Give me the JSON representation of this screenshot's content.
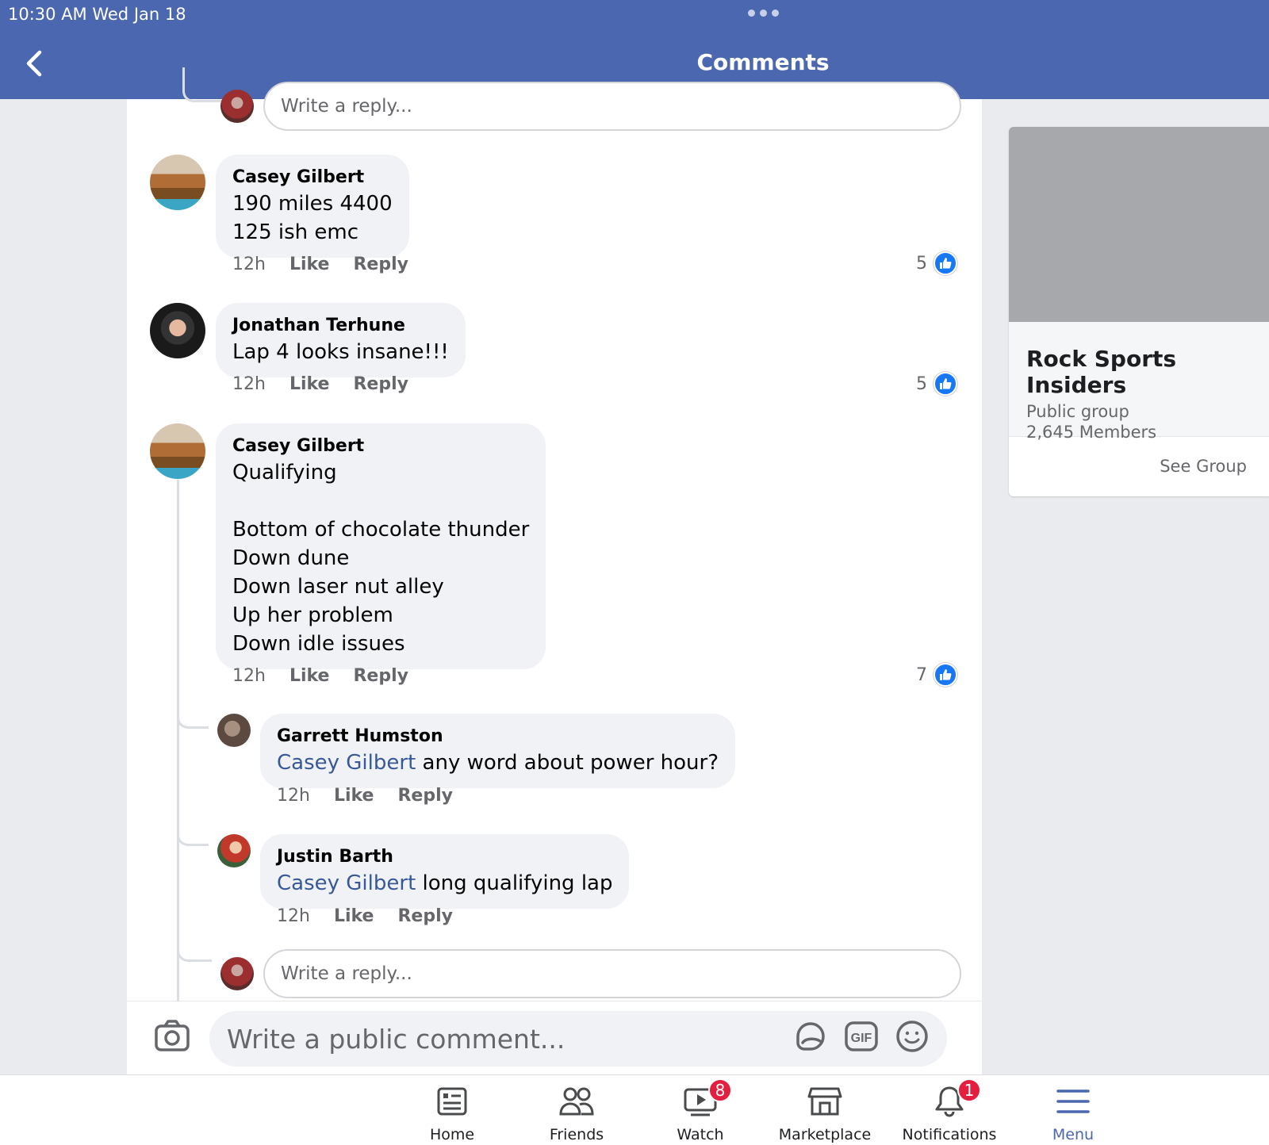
{
  "status_bar": {
    "time": "10:30 AM   Wed Jan 18"
  },
  "header": {
    "title": "Comments"
  },
  "reply_placeholder": "Write a reply...",
  "comments": [
    {
      "author": "Casey Gilbert",
      "text": "190 miles 4400\n125 ish emc",
      "time": "12h",
      "like": "Like",
      "reply": "Reply",
      "likes": "5"
    },
    {
      "author": "Jonathan Terhune",
      "text": "Lap 4 looks insane!!!",
      "time": "12h",
      "like": "Like",
      "reply": "Reply",
      "likes": "5"
    },
    {
      "author": "Casey Gilbert",
      "text": "Qualifying\n\nBottom of chocolate thunder\nDown dune\nDown laser nut alley\nUp her problem\nDown idle issues",
      "time": "12h",
      "like": "Like",
      "reply": "Reply",
      "likes": "7"
    }
  ],
  "replies": [
    {
      "author": "Garrett Humston",
      "mention": "Casey Gilbert",
      "text": " any word about power hour?",
      "time": "12h",
      "like": "Like",
      "reply": "Reply"
    },
    {
      "author": "Justin Barth",
      "mention": "Casey Gilbert",
      "text": " long qualifying lap",
      "time": "12h",
      "like": "Like",
      "reply": "Reply"
    }
  ],
  "composer": {
    "placeholder": "Write a public comment..."
  },
  "group": {
    "name": "Rock Sports Insiders",
    "type": "Public group",
    "members": "2,645 Members",
    "see_group": "See Group"
  },
  "tabs": [
    {
      "label": "Home",
      "icon": "home-icon"
    },
    {
      "label": "Friends",
      "icon": "friends-icon"
    },
    {
      "label": "Watch",
      "icon": "watch-icon",
      "badge": "8"
    },
    {
      "label": "Marketplace",
      "icon": "marketplace-icon"
    },
    {
      "label": "Notifications",
      "icon": "bell-icon",
      "badge": "1"
    },
    {
      "label": "Menu",
      "icon": "menu-icon",
      "active": true
    }
  ],
  "colors": {
    "header": "#4b67b0",
    "link": "#385898",
    "like_blue": "#1877f2",
    "badge": "#e41e3f"
  }
}
